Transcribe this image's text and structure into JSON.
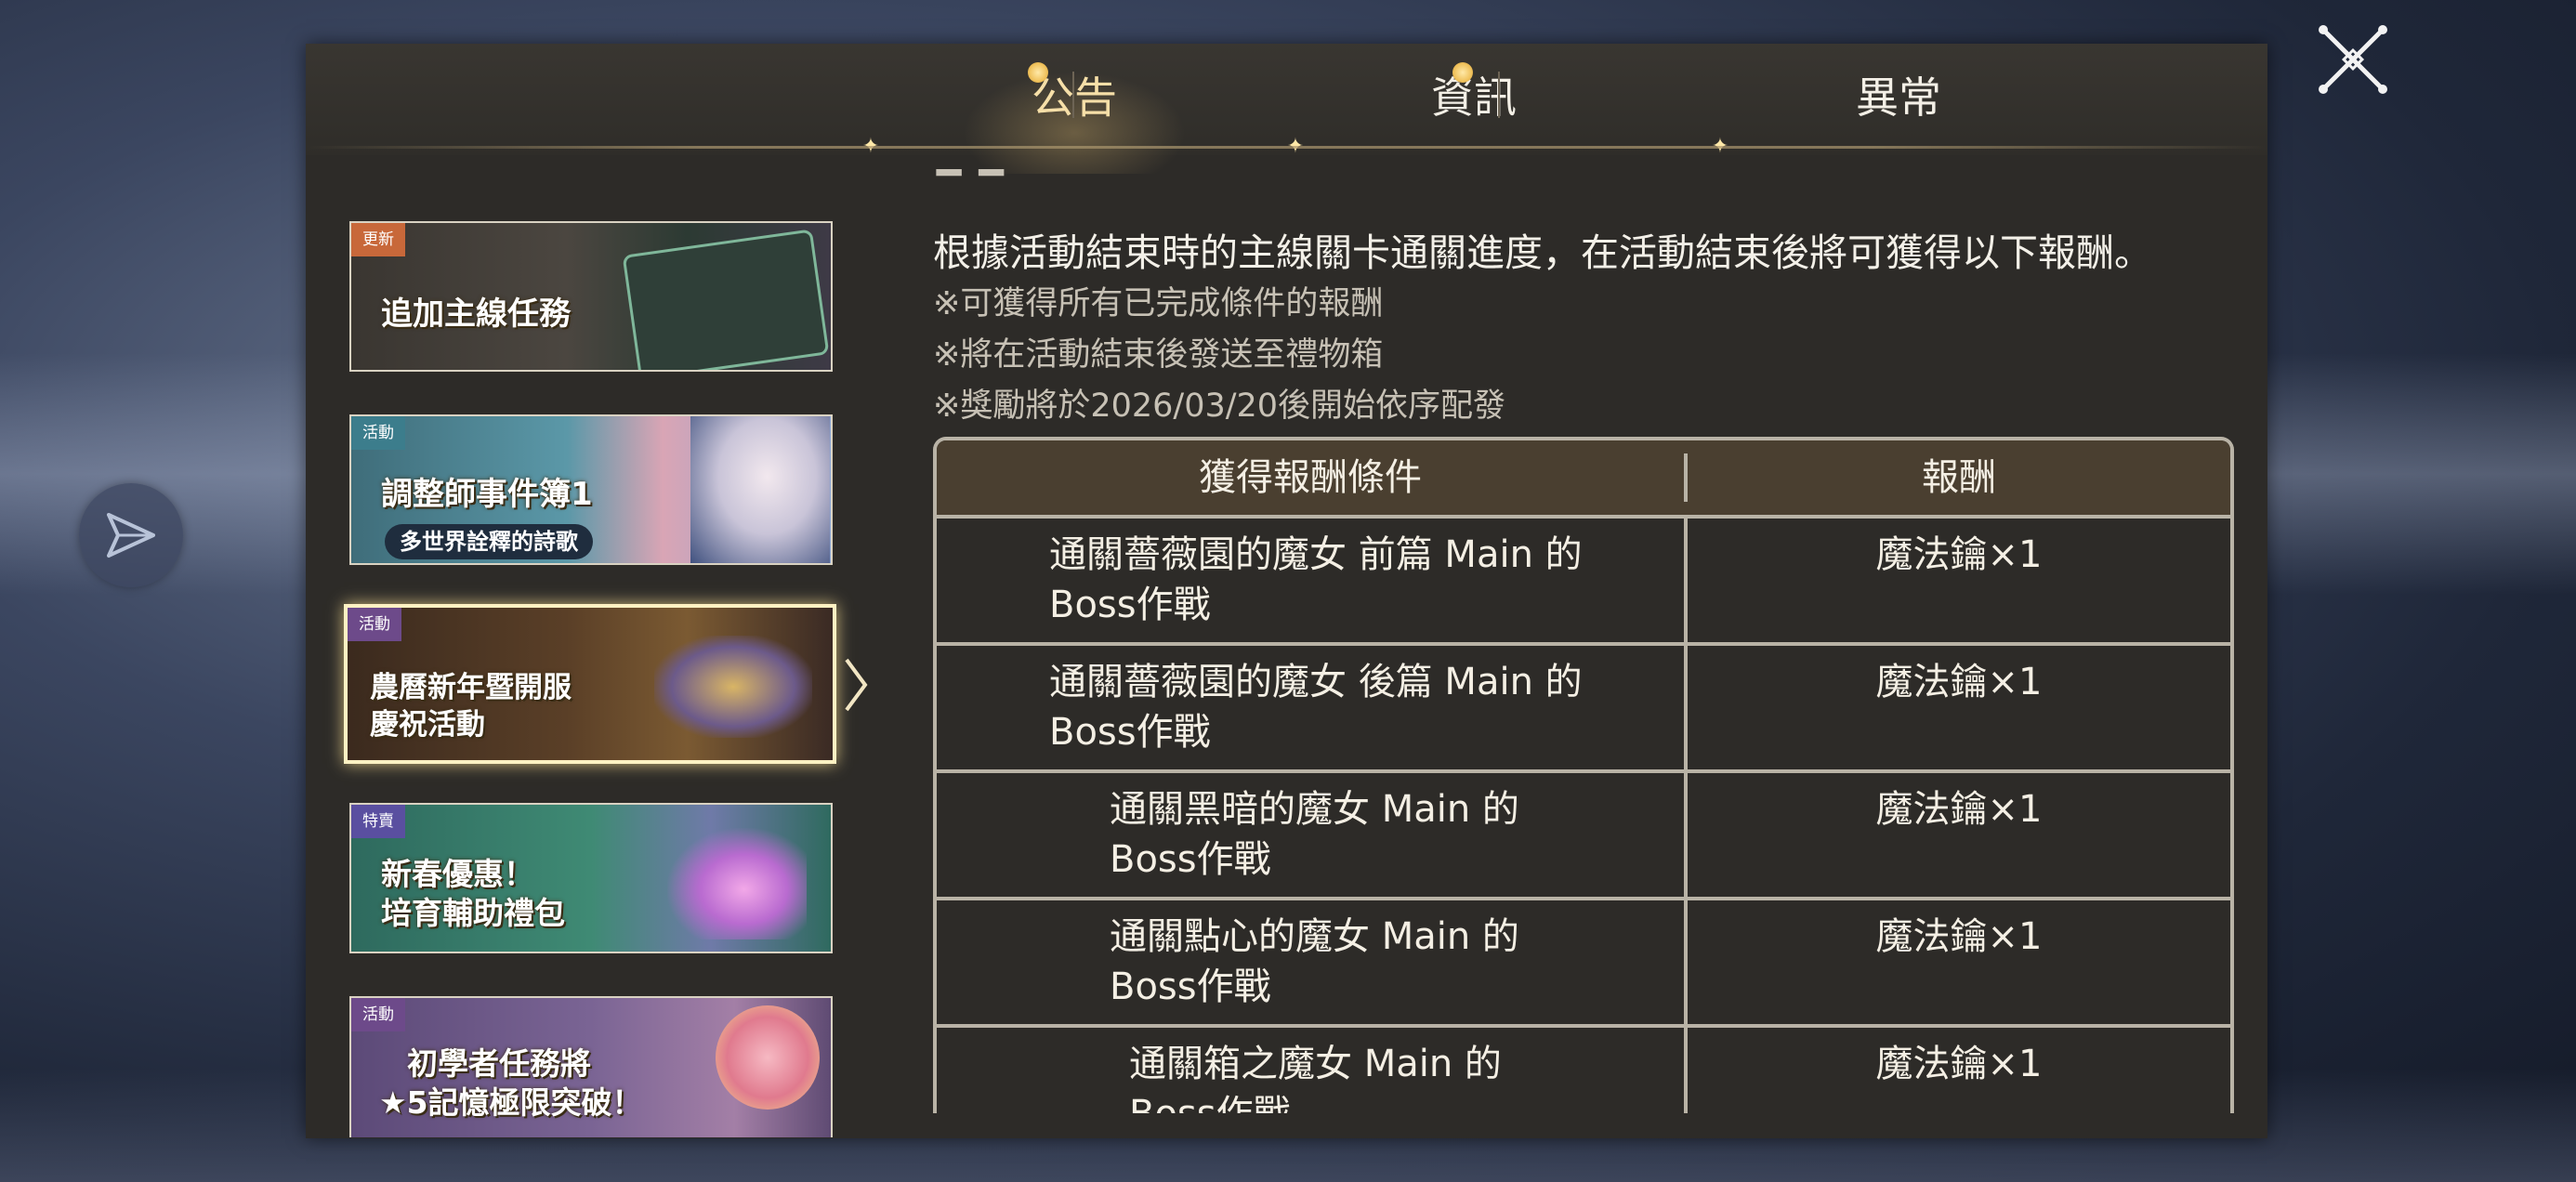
{
  "tabs": [
    {
      "label": "公告",
      "active": true
    },
    {
      "label": "資訊",
      "active": false
    },
    {
      "label": "異常",
      "active": false
    }
  ],
  "banners": [
    {
      "tag": "更新",
      "tag_color": "#c8683a",
      "title": "追加主線任務"
    },
    {
      "tag": "活動",
      "tag_color": "#3c7d8c",
      "title": "調整師事件簿1",
      "subtitle": "多世界詮釋的詩歌"
    },
    {
      "tag": "活動",
      "tag_color": "#6d4a8a",
      "title_line1": "農曆新年暨開服",
      "title_line2": "慶祝活動",
      "selected": true
    },
    {
      "tag": "特賣",
      "tag_color": "#5a4fa0",
      "title_line1": "新春優惠！",
      "title_line2": "培育輔助禮包"
    },
    {
      "tag": "活動",
      "tag_color": "#6d4a8a",
      "title_line1": "初學者任務將",
      "title_line2": "★5記憶極限突破！"
    }
  ],
  "content": {
    "intro": "根據活動結束時的主線關卡通關進度，在活動結束後將可獲得以下報酬。",
    "notes": [
      "※可獲得所有已完成條件的報酬",
      "※將在活動結束後發送至禮物箱",
      "※獎勵將於2026/03/20後開始依序配發"
    ]
  },
  "table": {
    "headers": {
      "condition": "獲得報酬條件",
      "reward": "報酬"
    },
    "rows": [
      {
        "condition": "通關薔薇園的魔女 前篇 Main 的\nBoss作戰",
        "reward": "魔法鑰×1"
      },
      {
        "condition": "通關薔薇園的魔女 後篇 Main 的\nBoss作戰",
        "reward": "魔法鑰×1"
      },
      {
        "condition": "通關黑暗的魔女 Main 的\nBoss作戰",
        "reward": "魔法鑰×1"
      },
      {
        "condition": "通關點心的魔女 Main 的\nBoss作戰",
        "reward": "魔法鑰×1"
      },
      {
        "condition": "通關箱之魔女 Main 的\nBoss作戰",
        "reward": "魔法鑰×1"
      }
    ]
  },
  "colors": {
    "panel_bg": "#2d2b28",
    "header_row_bg": "#4a3f30",
    "active_tab": "#f6dfa8",
    "notification_dot": "#f0c25c"
  },
  "icons": {
    "close": "close-x-icon",
    "side_button": "paper-plane-icon",
    "selection_arrow": "chevron-right-icon"
  }
}
